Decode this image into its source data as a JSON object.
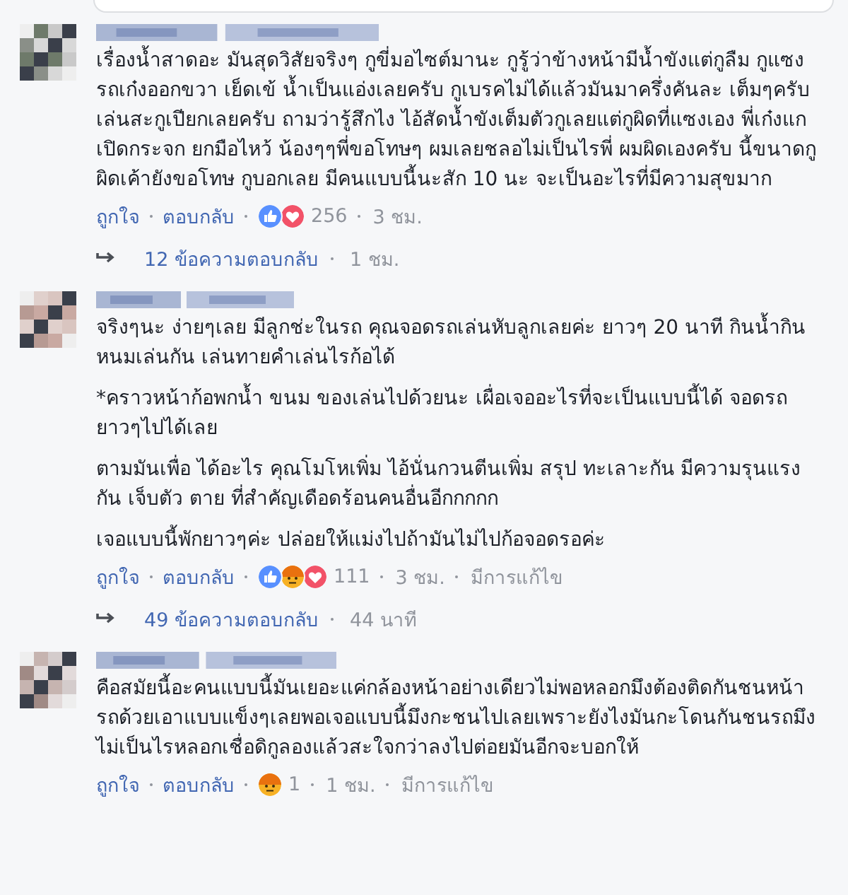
{
  "comments": [
    {
      "paragraphs": [
        "เรื่องน้ำสาดอะ มันสุดวิสัยจริงๆ กูขี่มอไซต์มานะ กูรู้ว่าข้างหน้ามีน้ำขังแต่กูลืม กูแซงรถเก๋งออกขวา เย็ดเข้ น้ำเป็นแอ่งเลยครับ กูเบรคไม่ได้แล้วมันมาครึ่งคันละ เต็มๆครับ เล่นสะกูเปียกเลยครับ ถามว่ารู้สึกไง ไอ้สัดน้ำขังเต็มตัวกูเลยแต่กูผิดที่แซงเอง พี่เก๋งแกเปิดกระจก ยกมือไหว้ น้องๆๆพี่ขอโทษๆ ผมเลยชลอไม่เป็นไรพี่ ผมผิดเองครับ นี้ขนาดกูผิดเค้ายังขอโทษ กูบอกเลย มีคนแบบนี้นะสัก 10 นะ จะเป็นอะไรที่มีความสุขมาก"
      ],
      "like": "ถูกใจ",
      "reply": "ตอบกลับ",
      "reactions": [
        {
          "kind": "like"
        },
        {
          "kind": "love"
        }
      ],
      "count": "256",
      "time": "3 ชม.",
      "replies": {
        "text": "12 ข้อความตอบกลับ",
        "time": "1 ชม."
      }
    },
    {
      "paragraphs": [
        "จริงๆนะ ง่ายๆเลย มีลูกช่ะในรถ คุณจอดรถเล่นหับลูกเลยค่ะ ยาวๆ 20 นาที กินน้ำกินหนมเล่นกัน เล่นทายคำเล่นไรก้อได้",
        "*คราวหน้าก้อพกน้ำ ขนม ของเล่นไปด้วยนะ เผื่อเจออะไรที่จะเป็นแบบนี้ได้ จอดรถยาวๆไปได้เลย",
        "ตามมันเพื่อ ได้อะไร คุณโมโหเพิ่ม ไอ้นั่นกวนตีนเพิ่ม สรุป ทะเลาะกัน มีความรุนแรงกัน เจ็บตัว ตาย ที่สำคัญเดือดร้อนคนอื่นอีกกกกก",
        "เจอแบบนี้พักยาวๆค่ะ ปล่อยให้แม่งไปถ้ามันไม่ไปก้อจอดรอค่ะ"
      ],
      "like": "ถูกใจ",
      "reply": "ตอบกลับ",
      "reactions": [
        {
          "kind": "like"
        },
        {
          "kind": "angry"
        },
        {
          "kind": "love"
        }
      ],
      "count": "111",
      "time": "3 ชม.",
      "edited": "มีการแก้ไข",
      "replies": {
        "text": "49 ข้อความตอบกลับ",
        "time": "44 นาที"
      }
    },
    {
      "paragraphs": [
        "คือสมัยนี้อะคนแบบนี้มันเยอะแค่กล้องหน้าอย่างเดียวไม่พอหลอกมึงต้องติดกันชนหน้ารถด้วยเอาแบบแข็งๆเลยพอเจอแบบนี้มึงกะชนไปเลยเพราะยังไงมันกะโดนกันชนรถมึงไม่เป็นไรหลอกเชื่อดิกูลองแล้วสะใจกว่าลงไปต่อยมันอีกจะบอกให้"
      ],
      "like": "ถูกใจ",
      "reply": "ตอบกลับ",
      "reactions": [
        {
          "kind": "angry"
        }
      ],
      "count": "1",
      "time": "1 ชม.",
      "edited": "มีการแก้ไข"
    }
  ]
}
